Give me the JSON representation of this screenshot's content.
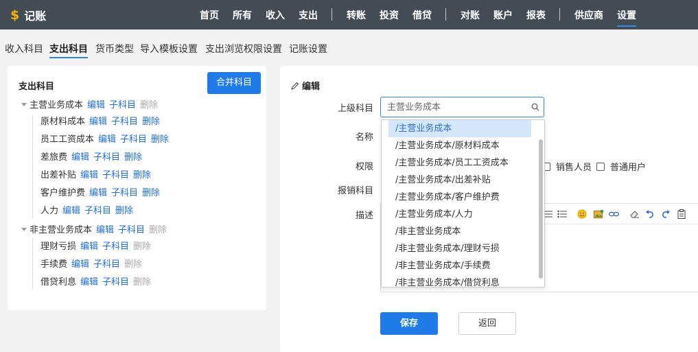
{
  "app": {
    "logo_text": "记账",
    "logo_symbol": "$"
  },
  "nav": {
    "items": [
      {
        "label": "首页"
      },
      {
        "label": "所有"
      },
      {
        "label": "收入"
      },
      {
        "label": "支出"
      },
      {
        "label": "转账"
      },
      {
        "label": "投资"
      },
      {
        "label": "借贷"
      },
      {
        "label": "对账"
      },
      {
        "label": "账户"
      },
      {
        "label": "报表"
      },
      {
        "label": "供应商"
      },
      {
        "label": "设置",
        "active": true
      }
    ]
  },
  "subtabs": [
    {
      "label": "收入科目"
    },
    {
      "label": "支出科目",
      "active": true
    },
    {
      "label": "货币类型"
    },
    {
      "label": "导入模板设置"
    },
    {
      "label": "支出浏览权限设置"
    },
    {
      "label": "记账设置"
    }
  ],
  "left": {
    "title": "支出科目",
    "merge_button": "合并科目",
    "actions": {
      "edit": "编辑",
      "child": "子科目",
      "delete": "删除"
    },
    "tree": [
      {
        "name": "主营业务成本",
        "level": 0,
        "delete_enabled": false
      },
      {
        "name": "原材料成本",
        "level": 1,
        "delete_enabled": true
      },
      {
        "name": "员工工资成本",
        "level": 1,
        "delete_enabled": true
      },
      {
        "name": "差旅费",
        "level": 1,
        "delete_enabled": true
      },
      {
        "name": "出差补贴",
        "level": 1,
        "delete_enabled": true
      },
      {
        "name": "客户维护费",
        "level": 1,
        "delete_enabled": true
      },
      {
        "name": "人力",
        "level": 1,
        "delete_enabled": true
      },
      {
        "name": "非主营业务成本",
        "level": 0,
        "delete_enabled": false
      },
      {
        "name": "理财亏损",
        "level": 1,
        "delete_enabled": false
      },
      {
        "name": "手续费",
        "level": 1,
        "delete_enabled": false
      },
      {
        "name": "借贷利息",
        "level": 1,
        "delete_enabled": false
      }
    ]
  },
  "edit": {
    "title": "编辑",
    "labels": {
      "parent": "上级科目",
      "name": "名称",
      "permission": "权限",
      "reimburse": "报销科目",
      "desc": "描述"
    },
    "parent_placeholder": "主营业务成本",
    "permissions": [
      {
        "label": "销售人员",
        "checked": false
      },
      {
        "label": "普通用户",
        "checked": false
      }
    ],
    "toolbar_icons": [
      "list-icon",
      "bullet-list-icon",
      "emoji-icon",
      "image-icon",
      "link-icon",
      "eraser-icon",
      "undo-icon",
      "redo-icon",
      "clipboard-icon"
    ],
    "save_button": "保存",
    "back_button": "返回"
  },
  "dropdown": {
    "options": [
      {
        "label": "/主营业务成本",
        "selected": true
      },
      {
        "label": "/主营业务成本/原材料成本"
      },
      {
        "label": "/主营业务成本/员工工资成本"
      },
      {
        "label": "/主营业务成本/出差补贴"
      },
      {
        "label": "/主营业务成本/客户维护费"
      },
      {
        "label": "/主营业务成本/人力"
      },
      {
        "label": "/非主营业务成本"
      },
      {
        "label": "/非主营业务成本/理财亏损"
      },
      {
        "label": "/非主营业务成本/手续费"
      },
      {
        "label": "/非主营业务成本/借贷利息"
      }
    ]
  },
  "colors": {
    "topbar": "#434b55",
    "accent": "#1e7be8",
    "link": "#1e6fd9",
    "logo": "#f5b400",
    "selected_bg": "#d5e8fb"
  }
}
